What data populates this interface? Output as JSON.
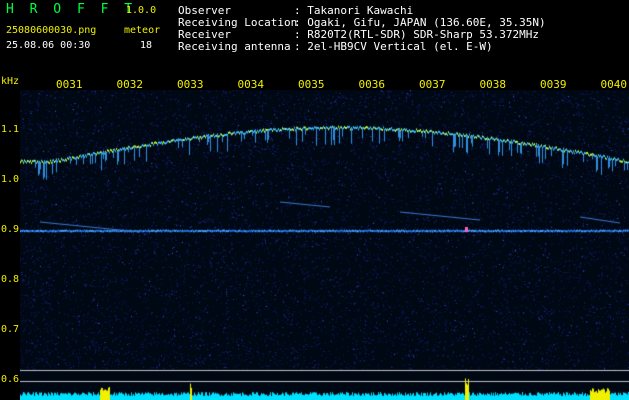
{
  "header": {
    "app_name": "H R O F F T",
    "version": "1.0.0",
    "filename": "25080600030.png",
    "datetime": "25.08.06 00:30",
    "meteor_label": "meteor",
    "meteor_count": "18",
    "fields": [
      {
        "label": "Observer",
        "value": ": Takanori Kawachi"
      },
      {
        "label": "Receiving Location",
        "value": ": Ogaki, Gifu, JAPAN (136.60E, 35.35N)"
      },
      {
        "label": "Receiver",
        "value": ": R820T2(RTL-SDR) SDR-Sharp 53.372MHz"
      },
      {
        "label": "Receiving antenna",
        "value": ": 2el-HB9CV Vertical (el. E-W)"
      }
    ]
  },
  "spectrogram": {
    "y_unit": "kHz",
    "y_ticks": [
      "1.1",
      "1.0",
      "0.9",
      "0.8",
      "0.7",
      "0.6"
    ],
    "y_tick_values": [
      1.1,
      1.0,
      0.9,
      0.8,
      0.7,
      0.6
    ],
    "x_ticks": [
      "0031",
      "0032",
      "0033",
      "0034",
      "0035",
      "0036",
      "0037",
      "0038",
      "0039",
      "0040"
    ],
    "colors": {
      "background": "#000814",
      "noise": "#1a2a8a",
      "carrier": "#40c0ff",
      "signal_hot": "#f0f000",
      "baseline": "#00e0ff"
    }
  }
}
